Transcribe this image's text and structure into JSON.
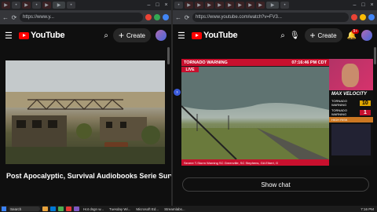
{
  "left_window": {
    "url": "https://www.y...",
    "header": {
      "logo": "YouTube",
      "create_label": "Create"
    },
    "video_title": "Post Apocalyptic, Survival Audiobooks Serie Survivor's Wrath | Full Audiobook"
  },
  "right_window": {
    "url": "https://www.youtube.com/watch?v=FV3...",
    "header": {
      "logo": "YouTube",
      "create_label": "Create",
      "notif_count": "9+"
    },
    "stream": {
      "banner_title": "TORNADO WARNING",
      "banner_time": "07:16:46 PM CDT",
      "live_label": "LIVE",
      "brand": "MAX VELOCITY",
      "counters": [
        {
          "label": "TORNADO WARNING",
          "value": "10"
        },
        {
          "label": "TORNADO WARNING",
          "value": "1"
        },
        {
          "label": "HIGH RISK",
          "value": ""
        }
      ],
      "footer": "Severe T-Storm Warning   SC  Greenville, SC   Stephens, GA   Elbert, G"
    },
    "show_chat_label": "Show chat"
  },
  "taskbar": {
    "search_placeholder": "Search",
    "items": [
      "Hot dsgn w...",
      "Tuesday Wi...",
      "Microsoft Ed...",
      "Streamlabs..."
    ],
    "time": "7:16 PM"
  }
}
